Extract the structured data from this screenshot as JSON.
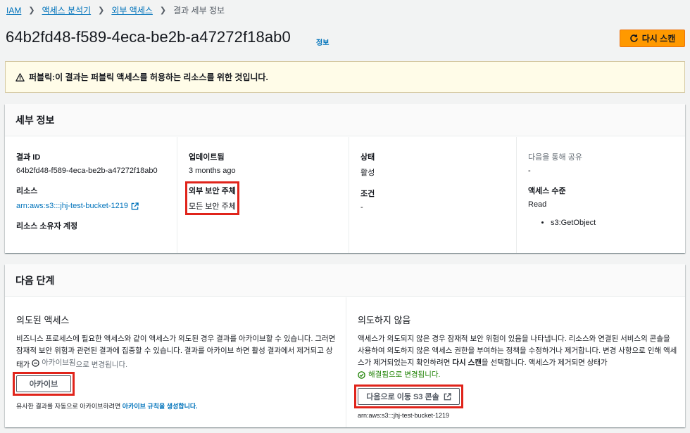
{
  "breadcrumb": [
    {
      "label": "IAM"
    },
    {
      "label": "액세스 분석기"
    },
    {
      "label": "외부 액세스"
    },
    {
      "label": "결과 세부 정보"
    }
  ],
  "page": {
    "title": "64b2fd48-f589-4eca-be2b-a47272f18ab0",
    "info_link": "정보",
    "rescan_label": "다시 스캔"
  },
  "warning": {
    "prefix": "퍼블릭:",
    "text": " 이 결과는 퍼블릭 액세스를 허용하는 리소스를 위한 것입니다."
  },
  "details": {
    "header": "세부 정보",
    "finding_id_label": "결과 ID",
    "finding_id_value": "64b2fd48-f589-4eca-be2b-a47272f18ab0",
    "resource_label": "리소스",
    "resource_value": "arn:aws:s3:::jhj-test-bucket-1219",
    "owner_label": "리소스 소유자 계정",
    "updated_label": "업데이트됨",
    "updated_value": "3 months ago",
    "principal_label": "외부 보안 주체",
    "principal_value": "모든 보안 주체",
    "status_label": "상태",
    "status_value": "활성",
    "condition_label": "조건",
    "condition_value": "-",
    "shared_label": "다음을 통해 공유",
    "shared_value": "-",
    "access_level_label": "액세스 수준",
    "access_level_value": "Read",
    "actions": [
      "s3:GetObject"
    ]
  },
  "next_steps": {
    "header": "다음 단계",
    "intended": {
      "title": "의도된 액세스",
      "desc": "비즈니스 프로세스에 필요한 액세스와 같이 액세스가 의도된 경우 결과를 아카이브할 수 있습니다. 그러면 잠재적 보안 위험과 관련된 결과에 집중할 수 있습니다. 결과를 아카이브 하면 활성 결과에서 제거되고 상태가 ",
      "status": "아카이브됨",
      "desc_suffix": "으로 변경됩니다.",
      "archive_label": "아카이브",
      "note_prefix": "유사한 결과를 자동으로 아카이브하려면 ",
      "note_link": "아카이브 규칙을 생성합니다."
    },
    "unintended": {
      "title": "의도하지 않음",
      "desc_part1": "액세스가 의도되지 않은 경우 잠재적 보안 위험이 있음을 나타냅니다. 리소스와 연결된 서비스의 콘솔을 사용하여 의도하지 않은 액세스 권한을 부여하는 정책을 수정하거나 제거합니다. 변경 사항으로 인해 액세스가 제거되었는지 확인하려면 ",
      "desc_bold": "다시 스캔",
      "desc_part2": "을 선택합니다. 액세스가 제거되면 상태가",
      "resolved_text": "해결됨으로 변경됩니다.",
      "console_label": "다음으로 이동 S3 콘솔",
      "arn": "arn:aws:s3:::jhj-test-bucket-1219"
    }
  },
  "colors": {
    "link": "#0073bb",
    "primary_button": "#ff9900",
    "warning_bg": "#fffce8",
    "success": "#1d8102",
    "highlight": "#e0241b"
  }
}
